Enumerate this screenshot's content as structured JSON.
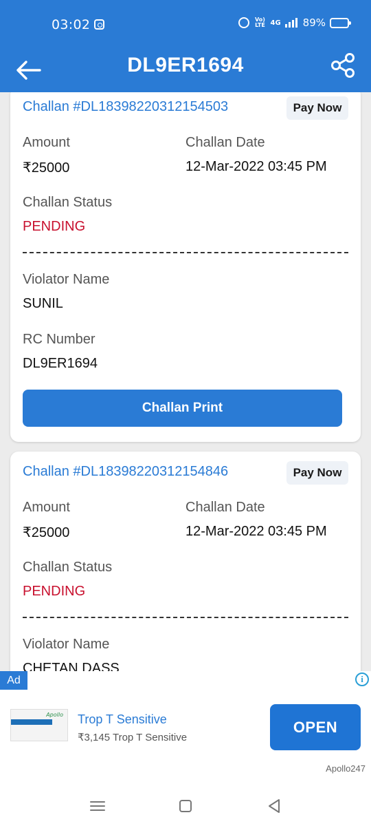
{
  "status_bar": {
    "time": "03:02",
    "volte_label": "Vo) LTE",
    "network": "4G",
    "battery": "89%",
    "battery_level_pct": 89,
    "icons": [
      "instagram-icon",
      "alarm-icon",
      "volte-icon",
      "signal-icon",
      "battery-icon"
    ]
  },
  "app_bar": {
    "title": "DL9ER1694",
    "back_icon": "arrow-left-icon",
    "share_icon": "share-icon"
  },
  "colors": {
    "primary": "#2a7bd5",
    "pending": "#c8102e",
    "background": "#ececec"
  },
  "challans": [
    {
      "number": "Challan #DL1839822031215450​3",
      "pay_label": "Pay Now",
      "amount_label": "Amount",
      "amount": "₹25000",
      "date_label": "Challan Date",
      "date": "12-Mar-2022 03:45 PM",
      "status_label": "Challan Status",
      "status": "PENDING",
      "violator_label": "Violator Name",
      "violator": "SUNIL",
      "rc_label": "RC Number",
      "rc": "DL9ER1694",
      "print_label": "Challan Print"
    },
    {
      "number": "Challan #DL18398220312154846",
      "pay_label": "Pay Now",
      "amount_label": "Amount",
      "amount": "₹25000",
      "date_label": "Challan Date",
      "date": "12-Mar-2022 03:45 PM",
      "status_label": "Challan Status",
      "status": "PENDING",
      "violator_label": "Violator Name",
      "violator": "CHETAN DASS"
    }
  ],
  "ad": {
    "badge": "Ad",
    "info_icon": "info-icon",
    "title": "Trop T Sensitive",
    "subtitle": "₹3,145 Trop T Sensitive",
    "cta": "OPEN",
    "brand": "Apollo247"
  },
  "nav": {
    "icons": [
      "menu-icon",
      "home-square-icon",
      "back-triangle-icon"
    ]
  }
}
